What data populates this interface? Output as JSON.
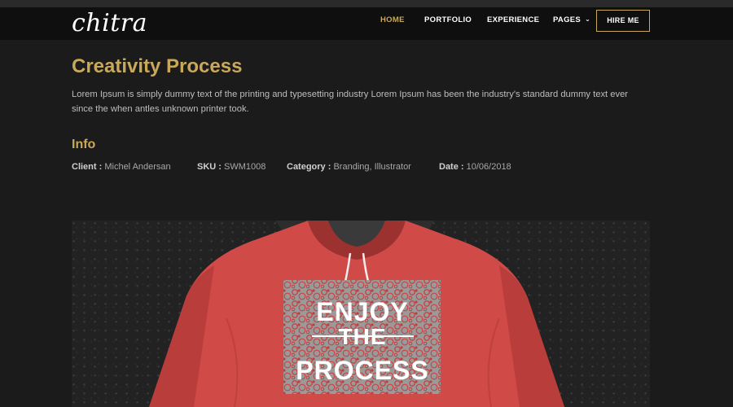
{
  "brand": {
    "logo_text": "chitra"
  },
  "nav": {
    "items": [
      {
        "label": "HOME",
        "active": true
      },
      {
        "label": "PORTFOLIO",
        "active": false
      },
      {
        "label": "EXPERIENCE",
        "active": false
      },
      {
        "label": "PAGES",
        "active": false
      }
    ],
    "cta_label": "HIRE ME"
  },
  "project": {
    "title": "Creativity Process",
    "description": "Lorem Ipsum is simply dummy text of the printing and typesetting industry Lorem Ipsum has been the industry's standard dummy text ever since the when antles unknown printer took.",
    "info_heading": "Info",
    "meta": {
      "client_label": "Client :",
      "client_value": "Michel Andersan",
      "sku_label": "SKU :",
      "sku_value": "SWM1008",
      "category_label": "Category :",
      "category_value": "Branding, Illustrator",
      "date_label": "Date :",
      "date_value": "10/06/2018"
    }
  },
  "hero_image": {
    "print_lines": [
      "ENJOY",
      "THE",
      "PROCESS"
    ]
  },
  "colors": {
    "accent": "#c9a959",
    "background": "#1b1b1b",
    "navbar": "#0f0f0f",
    "hoodie": "#d04a48"
  }
}
